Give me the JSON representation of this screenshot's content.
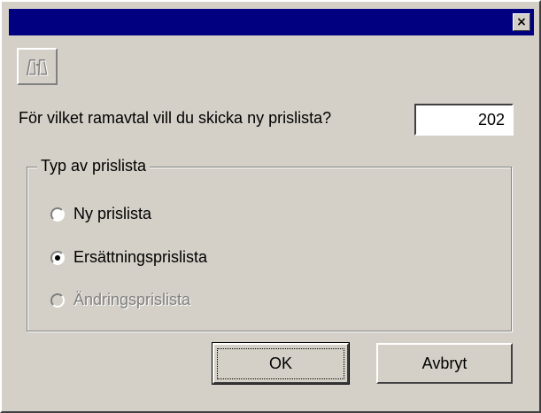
{
  "window": {
    "close_glyph": "×"
  },
  "toolbar": {
    "find_icon": "binoculars-icon"
  },
  "form": {
    "question": "För vilket ramavtal vill du skicka ny prislista?",
    "agreement_value": "202"
  },
  "price_list_type": {
    "title": "Typ av prislista",
    "options": [
      {
        "label": "Ny prislista",
        "selected": false,
        "enabled": true
      },
      {
        "label": "Ersättningsprislista",
        "selected": true,
        "enabled": true
      },
      {
        "label": "Ändringsprislista",
        "selected": false,
        "enabled": false
      }
    ]
  },
  "buttons": {
    "ok_label": "OK",
    "cancel_label": "Avbryt"
  },
  "colors": {
    "titlebar": "#000080",
    "face": "#d4d0c8",
    "disabled_text": "#808080"
  }
}
